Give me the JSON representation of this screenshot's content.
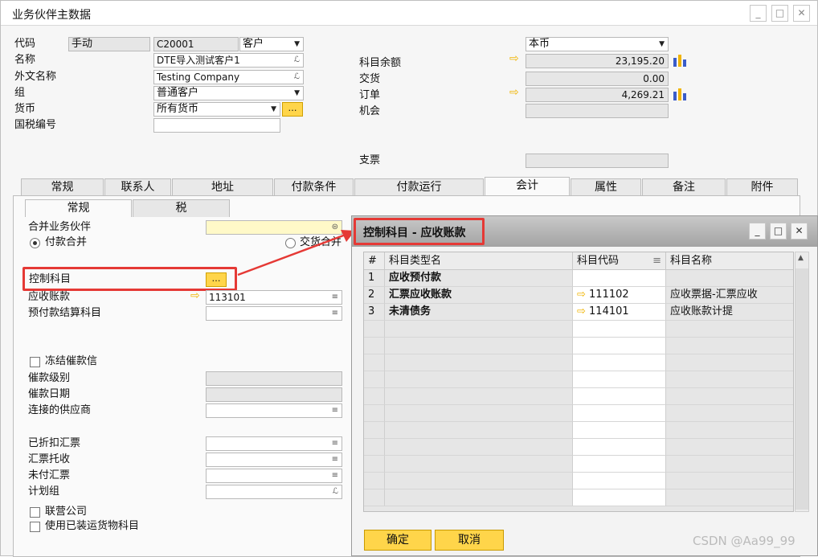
{
  "window": {
    "title": "业务伙伴主数据"
  },
  "header": {
    "code_label": "代码",
    "code_mode": "手动",
    "code_value": "C20001",
    "bp_type": "客户",
    "name_label": "名称",
    "name_value": "DTE导入测试客户1",
    "foreign_name_label": "外文名称",
    "foreign_name_value": "Testing Company",
    "group_label": "组",
    "group_value": "普通客户",
    "currency_label": "货币",
    "currency_value": "所有货币",
    "tax_no_label": "国税编号",
    "tax_no_value": "",
    "local_currency": "本币",
    "balance_label": "科目余额",
    "balance_value": "23,195.20",
    "delivery_label": "交货",
    "delivery_value": "0.00",
    "order_label": "订单",
    "order_value": "4,269.21",
    "opportunity_label": "机会",
    "opportunity_value": "",
    "cheque_label": "支票",
    "cheque_value": ""
  },
  "tabs": [
    "常规",
    "联系人",
    "地址",
    "付款条件",
    "付款运行",
    "会计",
    "属性",
    "备注",
    "附件"
  ],
  "subtabs": [
    "常规",
    "税"
  ],
  "accounting": {
    "consolidating_bp_label": "合并业务伙伴",
    "payment_consolidation": "付款合并",
    "delivery_consolidation": "交货合并",
    "control_account_label": "控制科目",
    "receivable_label": "应收账款",
    "receivable_value": "113101",
    "down_payment_label": "预付款结算科目",
    "block_dunning_label": "冻结催款信",
    "dunning_level_label": "催款级别",
    "dunning_date_label": "催款日期",
    "linked_vendor_label": "连接的供应商",
    "bills_discounted_label": "已折扣汇票",
    "bills_collection_label": "汇票托收",
    "unpaid_bills_label": "未付汇票",
    "planning_group_label": "计划组",
    "affiliate_label": "联营公司",
    "goods_shipped_label": "使用已装运货物科目"
  },
  "dialog": {
    "title": "控制科目 - 应收账款",
    "columns": [
      "#",
      "科目类型名",
      "科目代码",
      "科目名称"
    ],
    "rows": [
      {
        "num": "1",
        "type": "应收预付款",
        "code": "",
        "name": ""
      },
      {
        "num": "2",
        "type": "汇票应收账款",
        "code": "111102",
        "name": "应收票据-汇票应收"
      },
      {
        "num": "3",
        "type": "未清债务",
        "code": "114101",
        "name": "应收账款计提"
      }
    ],
    "ok_label": "确定",
    "cancel_label": "取消"
  },
  "watermark": "CSDN @Aa99_99",
  "colors": {
    "highlight_red": "#e53935",
    "button_yellow": "#ffd54a",
    "arrow_orange": "#f0b400"
  }
}
